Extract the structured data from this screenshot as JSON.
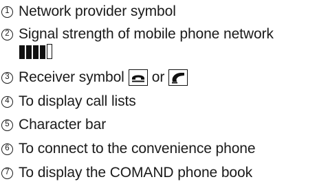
{
  "items": [
    {
      "num": "1",
      "text": "Network provider symbol"
    },
    {
      "num": "2",
      "text": "Signal strength of mobile phone network"
    },
    {
      "num": "3",
      "text": "Receiver symbol",
      "joiner": "or"
    },
    {
      "num": "4",
      "text": "To display call lists"
    },
    {
      "num": "5",
      "text": "Character bar"
    },
    {
      "num": "6",
      "text": "To connect to the convenience phone"
    },
    {
      "num": "7",
      "text": "To display the COMAND phone book"
    }
  ],
  "signal": {
    "filled_bars": 4,
    "total_bars": 5
  },
  "icons": {
    "receiver_hung_up": "receiver-down-icon",
    "receiver_lifted": "receiver-up-icon"
  }
}
